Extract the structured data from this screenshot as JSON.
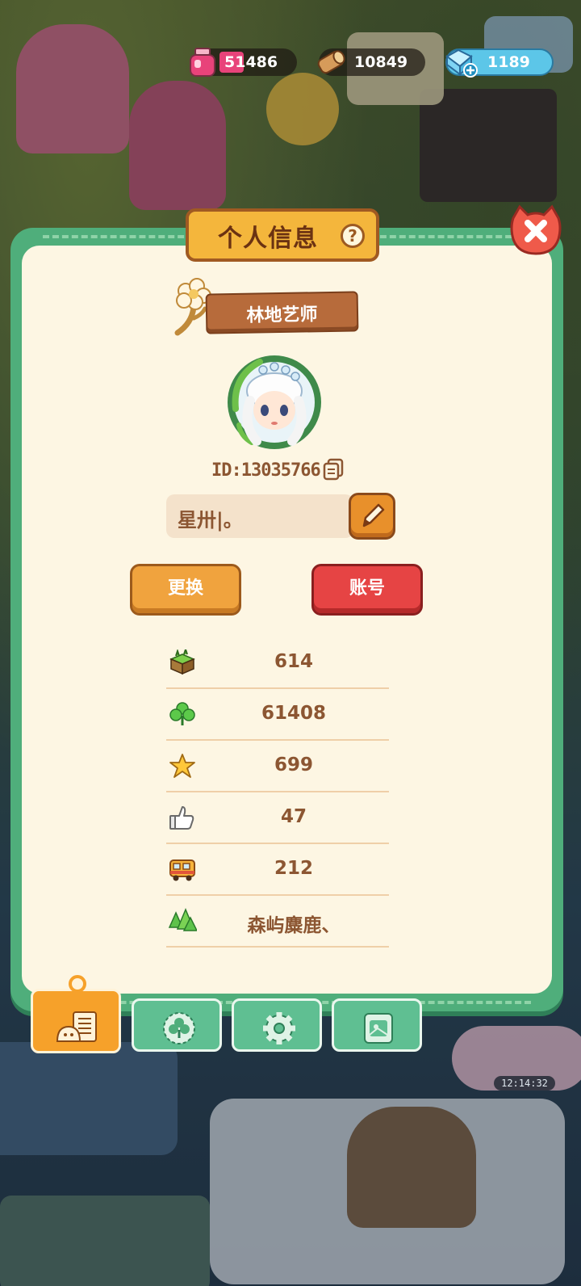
{
  "resources": {
    "ink": "51486",
    "wood": "10849",
    "gems": "1189"
  },
  "panel": {
    "title": "个人信息",
    "help_label": "?"
  },
  "profile": {
    "badge_title": "林地艺师",
    "id_text": "ID:13035766",
    "name": "星卅|。",
    "swap_button": "更换",
    "account_button": "账号"
  },
  "stats": [
    {
      "icon": "grass-block-icon",
      "value": "614"
    },
    {
      "icon": "clover-icon",
      "value": "61408"
    },
    {
      "icon": "star-icon",
      "value": "699"
    },
    {
      "icon": "thumbs-up-icon",
      "value": "47"
    },
    {
      "icon": "bus-icon",
      "value": "212"
    },
    {
      "icon": "forest-icon",
      "value": "森屿麋鹿、"
    }
  ],
  "tabs": [
    {
      "name": "profile",
      "active": true
    },
    {
      "name": "badges",
      "active": false
    },
    {
      "name": "settings",
      "active": false
    },
    {
      "name": "album",
      "active": false
    }
  ],
  "clock": "12:14:32",
  "colors": {
    "panel_green": "#4fae7b",
    "panel_cream": "#fdf6e3",
    "text_brown": "#8c5632",
    "accent_orange": "#f0a33e",
    "accent_red": "#e64444"
  }
}
